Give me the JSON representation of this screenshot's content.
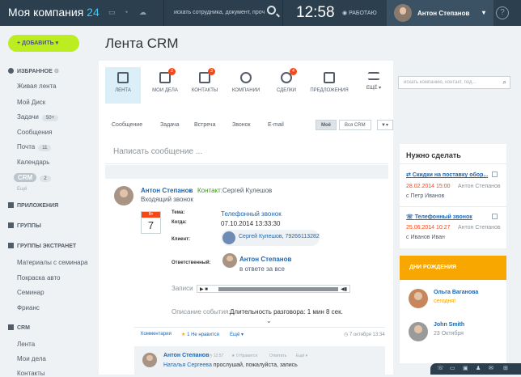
{
  "topbar": {
    "brand": "Моя компания",
    "brand_num": "24",
    "search_placeholder": "искать сотрудника, документ, прочее...",
    "clock": "12:58",
    "work_status": "РАБОТАЮ",
    "user_name": "Антон Степанов",
    "help": "?"
  },
  "sidebar": {
    "add_button": "ДОБАВИТЬ",
    "favorites": "ИЗБРАННОЕ",
    "items": [
      {
        "label": "Живая лента"
      },
      {
        "label": "Мой Диск"
      },
      {
        "label": "Задачи",
        "count": "50+"
      },
      {
        "label": "Сообщения"
      },
      {
        "label": "Почта",
        "count": "11"
      },
      {
        "label": "Календарь"
      },
      {
        "label": "CRM",
        "count": "2"
      }
    ],
    "more": "Ещё",
    "apps": "ПРИЛОЖЕНИЯ",
    "groups": "ГРУППЫ",
    "extranet": "ГРУППЫ ЭКСТРАНЕТ",
    "extranet_items": [
      "Материалы с семинара",
      "Покраска авто",
      "Семинар",
      "Фрианс"
    ],
    "crm": "CRM",
    "crm_items": [
      "Лента",
      "Мои дела",
      "Контакты"
    ]
  },
  "page": {
    "title": "Лента CRM"
  },
  "toolbar": {
    "items": [
      {
        "label": "ЛЕНТА"
      },
      {
        "label": "МОИ ДЕЛА",
        "badge": "2"
      },
      {
        "label": "КОНТАКТЫ",
        "badge": "3"
      },
      {
        "label": "КОМПАНИИ"
      },
      {
        "label": "СДЕЛКИ",
        "badge": "4"
      },
      {
        "label": "ПРЕДЛОЖЕНИЯ"
      },
      {
        "label": "ЕЩЁ"
      }
    ],
    "search_placeholder": "искать компанию, контакт, под..."
  },
  "filters": {
    "tabs": [
      "Сообщение",
      "Задача",
      "Встреча",
      "Звонок",
      "E-mail"
    ],
    "mine": "Моё",
    "all": "Вся CRM"
  },
  "composer": {
    "placeholder": "Написать сообщение ..."
  },
  "post": {
    "author": "Антон Степанов",
    "contact_label": "Контакт:",
    "contact_name": "Сергей Кулешов",
    "subtitle": "Входящий звонок",
    "cal_weekday": "Вт",
    "cal_day": "7",
    "theme_label": "Тема:",
    "theme": "Телефонный звонок",
    "when_label": "Когда:",
    "when": "07.10.2014 13:33:30",
    "client_label": "Клиент:",
    "client": "Сергей Кулешов, 79266113282",
    "resp_label": "Ответственный:",
    "resp_name": "Антон Степанов",
    "resp_status": "в ответе за все",
    "records_label": "Записи",
    "desc_label": "Описание события:",
    "desc": "Длительность разговора: 1 мин 8 сек.",
    "actions_comments": "Комментарии",
    "actions_like": "1 Не нравится",
    "actions_more": "Ещё",
    "date": "7 октября 13:34"
  },
  "comment": {
    "author": "Антон Степанов",
    "time": "12:57",
    "likes": "0 Нравится",
    "reply": "Ответить",
    "more": "Ещё",
    "link": "Наталья Сергеева",
    "text": "прослушай, пожалуйста, запись"
  },
  "todo": {
    "title": "Нужно сделать",
    "tasks": [
      {
        "title": "Скидки на поставку обор...",
        "date": "28.02.2014 15:00",
        "owner": "Антон Степанов",
        "with": "с Петр Иванов"
      },
      {
        "title": "Телефонный звонок",
        "date": "25.06.2014 10:27",
        "owner": "Антон Степанов",
        "with": "с Иванов Иван"
      }
    ]
  },
  "birthdays": {
    "title": "ДНИ РОЖДЕНИЯ",
    "people": [
      {
        "name": "Ольга Ваганова",
        "date": "сегодня!"
      },
      {
        "name": "John Smith",
        "date": "23 Октября"
      }
    ]
  },
  "colors": {
    "accent": "#bbed21",
    "header": "#2b3f4e",
    "link": "#2067b0",
    "badge": "#f54819",
    "birthday": "#f7a700"
  }
}
